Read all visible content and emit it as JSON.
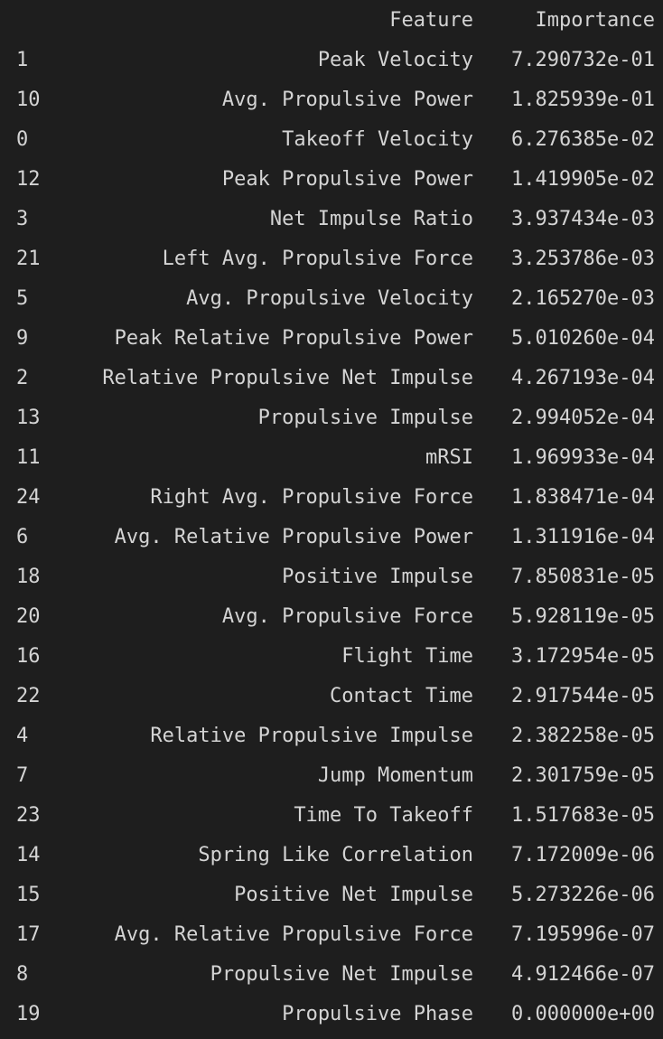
{
  "table": {
    "columns": [
      "Feature",
      "Importance"
    ],
    "rows": [
      {
        "index": "1",
        "feature": "Peak Velocity",
        "importance": "7.290732e-01"
      },
      {
        "index": "10",
        "feature": "Avg. Propulsive Power",
        "importance": "1.825939e-01"
      },
      {
        "index": "0",
        "feature": "Takeoff Velocity",
        "importance": "6.276385e-02"
      },
      {
        "index": "12",
        "feature": "Peak Propulsive Power",
        "importance": "1.419905e-02"
      },
      {
        "index": "3",
        "feature": "Net Impulse Ratio",
        "importance": "3.937434e-03"
      },
      {
        "index": "21",
        "feature": "Left Avg. Propulsive Force",
        "importance": "3.253786e-03"
      },
      {
        "index": "5",
        "feature": "Avg. Propulsive Velocity",
        "importance": "2.165270e-03"
      },
      {
        "index": "9",
        "feature": "Peak Relative Propulsive Power",
        "importance": "5.010260e-04"
      },
      {
        "index": "2",
        "feature": "Relative Propulsive Net Impulse",
        "importance": "4.267193e-04"
      },
      {
        "index": "13",
        "feature": "Propulsive Impulse",
        "importance": "2.994052e-04"
      },
      {
        "index": "11",
        "feature": "mRSI",
        "importance": "1.969933e-04"
      },
      {
        "index": "24",
        "feature": "Right Avg. Propulsive Force",
        "importance": "1.838471e-04"
      },
      {
        "index": "6",
        "feature": "Avg. Relative Propulsive Power",
        "importance": "1.311916e-04"
      },
      {
        "index": "18",
        "feature": "Positive Impulse",
        "importance": "7.850831e-05"
      },
      {
        "index": "20",
        "feature": "Avg. Propulsive Force",
        "importance": "5.928119e-05"
      },
      {
        "index": "16",
        "feature": "Flight Time",
        "importance": "3.172954e-05"
      },
      {
        "index": "22",
        "feature": "Contact Time",
        "importance": "2.917544e-05"
      },
      {
        "index": "4",
        "feature": "Relative Propulsive Impulse",
        "importance": "2.382258e-05"
      },
      {
        "index": "7",
        "feature": "Jump Momentum",
        "importance": "2.301759e-05"
      },
      {
        "index": "23",
        "feature": "Time To Takeoff",
        "importance": "1.517683e-05"
      },
      {
        "index": "14",
        "feature": "Spring Like Correlation",
        "importance": "7.172009e-06"
      },
      {
        "index": "15",
        "feature": "Positive Net Impulse",
        "importance": "5.273226e-06"
      },
      {
        "index": "17",
        "feature": "Avg. Relative Propulsive Force",
        "importance": "7.195996e-07"
      },
      {
        "index": "8",
        "feature": "Propulsive Net Impulse",
        "importance": "4.912466e-07"
      },
      {
        "index": "19",
        "feature": "Propulsive Phase",
        "importance": "0.000000e+00"
      }
    ]
  }
}
